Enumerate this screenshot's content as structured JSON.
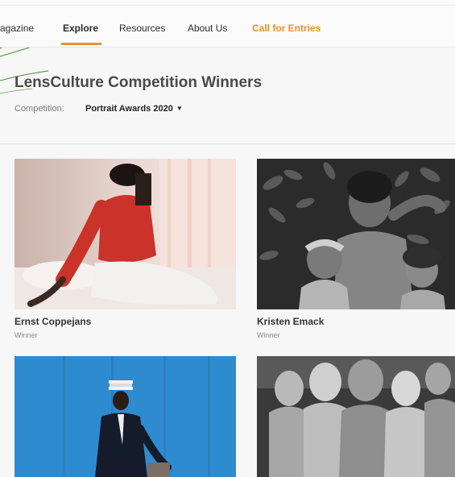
{
  "nav": {
    "items": [
      "agazine",
      "Explore",
      "Resources",
      "About Us"
    ],
    "cta": "Call for Entries",
    "active": "Explore"
  },
  "page": {
    "title": "LensCulture Competition Winners",
    "filter_label": "Competition:",
    "filter_value": "Portrait Awards 2020"
  },
  "winners": [
    {
      "name": "Ernst Coppejans",
      "award": "Winner"
    },
    {
      "name": "Kristen Emack",
      "award": "Winner"
    }
  ],
  "colors": {
    "accent": "#e8912b",
    "deco_green": "#4f8a3a"
  }
}
